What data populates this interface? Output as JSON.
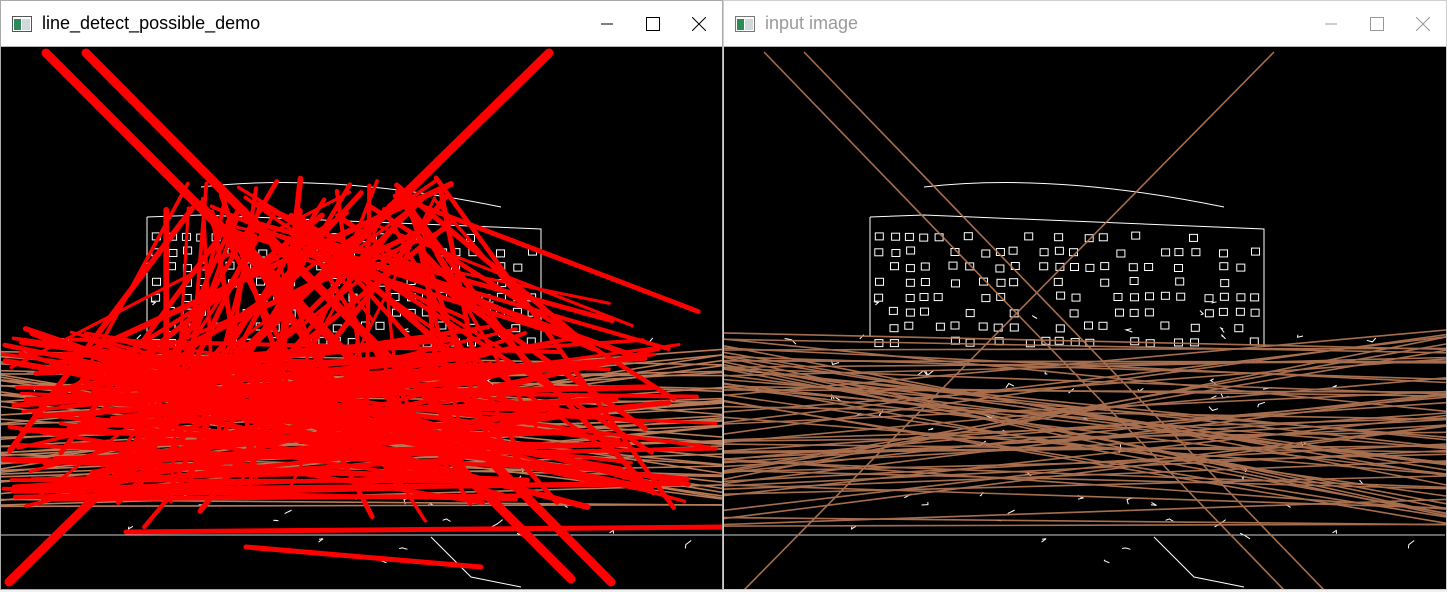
{
  "windows": {
    "left": {
      "title": "line_detect_possible_demo",
      "active": true
    },
    "right": {
      "title": "input image",
      "active": false
    }
  },
  "icons": {
    "app": "opencv-window-icon",
    "minimize": "minimize-icon",
    "maximize": "maximize-icon",
    "close": "close-icon"
  },
  "colors": {
    "detected_lines": "#ff0000",
    "hough_lines": "#b97a57",
    "edges": "#ffffff",
    "background": "#000000"
  }
}
